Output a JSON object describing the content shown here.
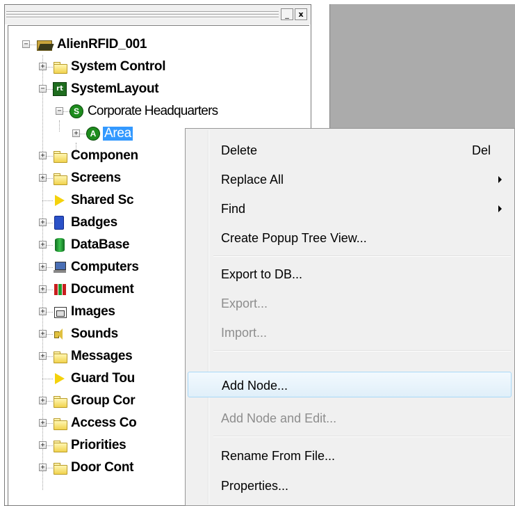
{
  "panel": {
    "min_button": "_",
    "close_button": "x"
  },
  "tree": {
    "root": "AlienRFID_001",
    "system_control": "System Control",
    "system_layout": "SystemLayout",
    "corporate_hq": "Corporate Headquarters",
    "area": "Area",
    "items": [
      "Componen",
      "Screens",
      "Shared Sc",
      "Badges",
      "DataBase",
      "Computers",
      "Document",
      "Images",
      "Sounds",
      "Messages",
      "Guard Tou",
      "Group Cor",
      "Access Co",
      "Priorities",
      "Door Cont"
    ]
  },
  "context_menu": {
    "delete": "Delete",
    "delete_shortcut": "Del",
    "replace_all": "Replace All",
    "find": "Find",
    "create_popup": "Create Popup Tree View...",
    "export_db": "Export to DB...",
    "export": "Export...",
    "import": "Import...",
    "add_node": "Add Node...",
    "add_node_edit": "Add Node and Edit...",
    "rename_from_file": "Rename From File...",
    "properties": "Properties..."
  },
  "colors": {
    "selection": "#3399ff",
    "menu_bg": "#f0f0f0",
    "grey_area": "#ababab"
  }
}
